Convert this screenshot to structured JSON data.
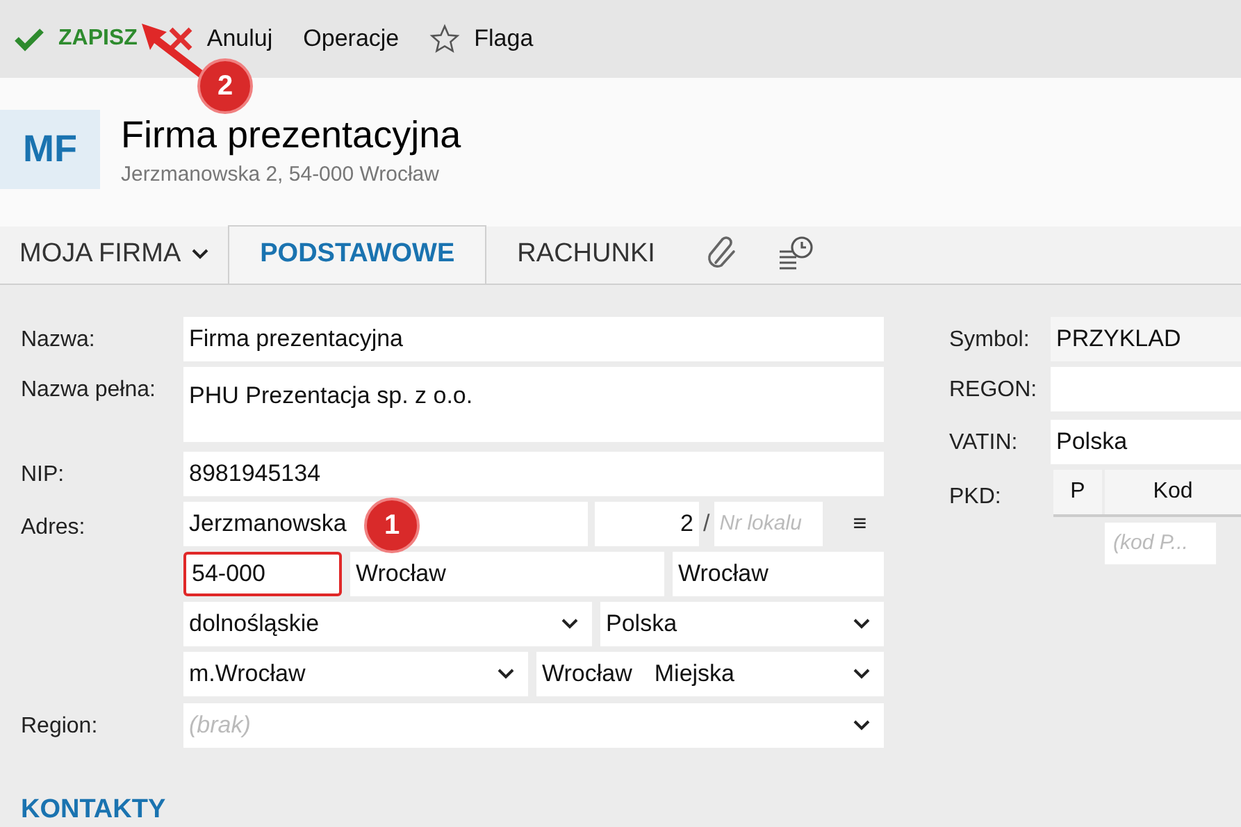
{
  "toolbar": [
    {
      "kind": "save",
      "label": "ZAPISZ"
    },
    {
      "kind": "cancel",
      "label": "Anuluj"
    },
    {
      "kind": "plain",
      "label": "Operacje"
    },
    {
      "kind": "flag",
      "label": "Flaga"
    }
  ],
  "header": {
    "avatar": "MF",
    "title": "Firma prezentacyjna",
    "subtitle": "Jerzmanowska 2, 54-000 Wrocław"
  },
  "tabs": [
    {
      "kind": "menu",
      "label": "MOJA FIRMA",
      "selected": false
    },
    {
      "kind": "text",
      "label": "PODSTAWOWE",
      "selected": true
    },
    {
      "kind": "text",
      "label": "RACHUNKI",
      "selected": false
    },
    {
      "kind": "attach",
      "selected": false
    },
    {
      "kind": "history",
      "selected": false
    }
  ],
  "form": {
    "name_label": "Nazwa:",
    "name": "Firma prezentacyjna",
    "full_name_label": "Nazwa pełna:",
    "full_name": "PHU Prezentacja sp. z o.o.",
    "nip_label": "NIP:",
    "nip": "8981945134",
    "address_label": "Adres:",
    "street": "Jerzmanowska",
    "number": "2",
    "slash": "/",
    "flat_placeholder": "Nr lokalu",
    "menu_glyph": "≡",
    "postal_code": "54-000",
    "postal_code_highlighted": true,
    "city": "Wrocław",
    "post_office": "Wrocław",
    "voivodeship": "dolnośląskie",
    "country": "Polska",
    "district": "m.Wrocław",
    "commune": "Wrocław",
    "commune_type": "Miejska",
    "region_label": "Region:",
    "region_placeholder": "(brak)"
  },
  "side": {
    "symbol_label": "Symbol:",
    "symbol": "PRZYKLAD",
    "regon_label": "REGON:",
    "vatin_label": "VATIN:",
    "vatin": "Polska",
    "pkd_label": "PKD:",
    "pkd_columns": [
      "P",
      "Kod"
    ],
    "pkd_placeholder": "(kod P..."
  },
  "section": "KONTAKTY",
  "annotations": [
    {
      "label": "1"
    },
    {
      "label": "2"
    }
  ]
}
